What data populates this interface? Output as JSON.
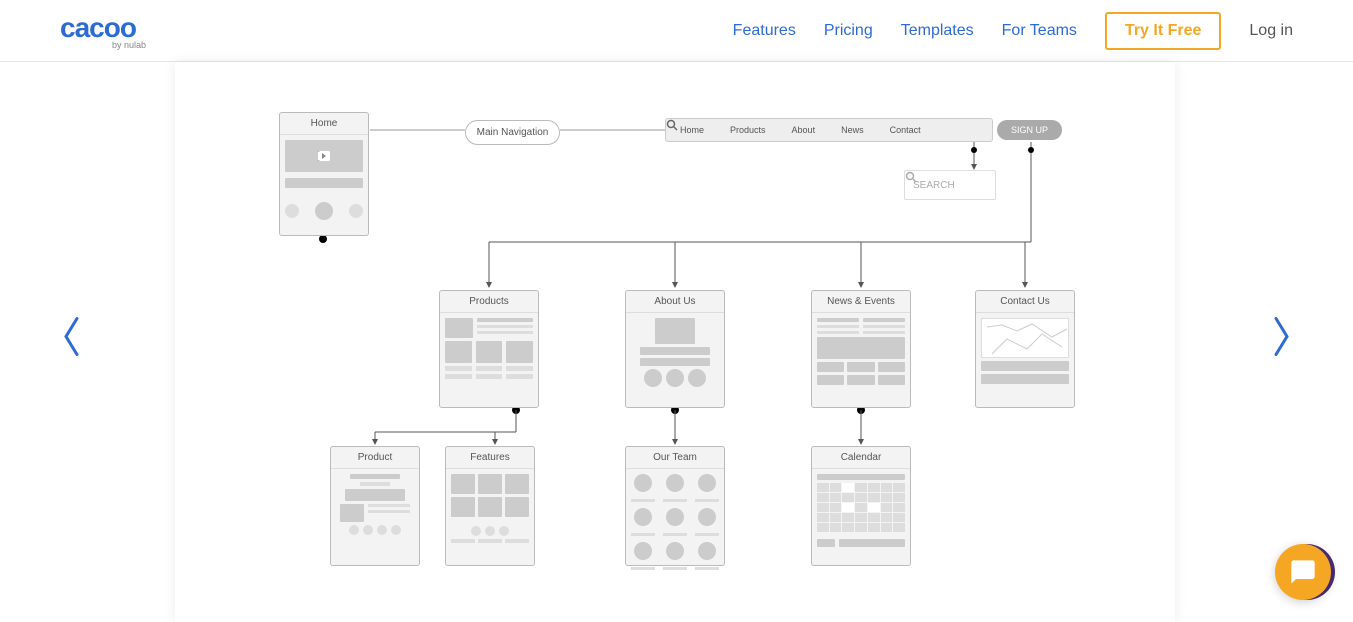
{
  "header": {
    "logo_text": "cacoo",
    "logo_sub": "by nulab",
    "nav": {
      "features": "Features",
      "pricing": "Pricing",
      "templates": "Templates",
      "for_teams": "For Teams",
      "try_free": "Try It Free",
      "login": "Log in"
    }
  },
  "diagram": {
    "home_card": "Home",
    "main_nav_pill": "Main Navigation",
    "navbar": {
      "home": "Home",
      "products": "Products",
      "about": "About",
      "news": "News",
      "contact": "Contact",
      "signup": "SIGN UP"
    },
    "search_box": "SEARCH",
    "products_card": "Products",
    "about_us_card": "About Us",
    "news_events_card": "News & Events",
    "contact_us_card": "Contact Us",
    "product_card": "Product",
    "features_card": "Features",
    "our_team_card": "Our Team",
    "calendar_card": "Calendar"
  }
}
